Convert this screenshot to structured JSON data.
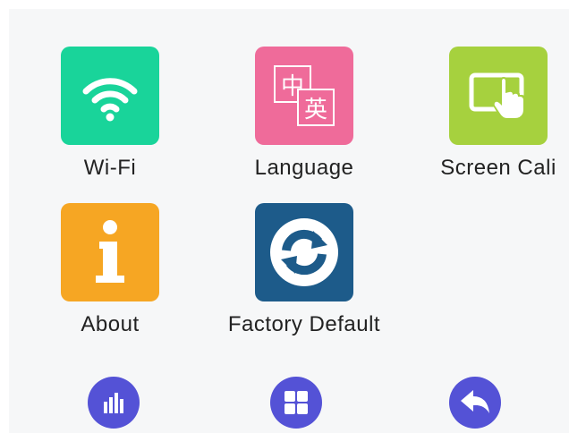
{
  "menu": {
    "items": [
      {
        "label": "Wi-Fi",
        "icon": "wifi-icon",
        "color": "#19d49a"
      },
      {
        "label": "Language",
        "icon": "language-icon",
        "color": "#ef6b9a",
        "glyph_top": "中",
        "glyph_bottom": "英"
      },
      {
        "label": "Screen Cali",
        "icon": "touch-screen-icon",
        "color": "#a6d13e"
      },
      {
        "label": "About",
        "icon": "info-icon",
        "color": "#f6a623"
      },
      {
        "label": "Factory Default",
        "icon": "refresh-icon",
        "color": "#1d5b8a"
      }
    ]
  },
  "bottom_bar": {
    "color": "#5452d6",
    "buttons": [
      {
        "icon": "bar-chart-icon"
      },
      {
        "icon": "grid-icon"
      },
      {
        "icon": "back-arrow-icon"
      }
    ]
  }
}
